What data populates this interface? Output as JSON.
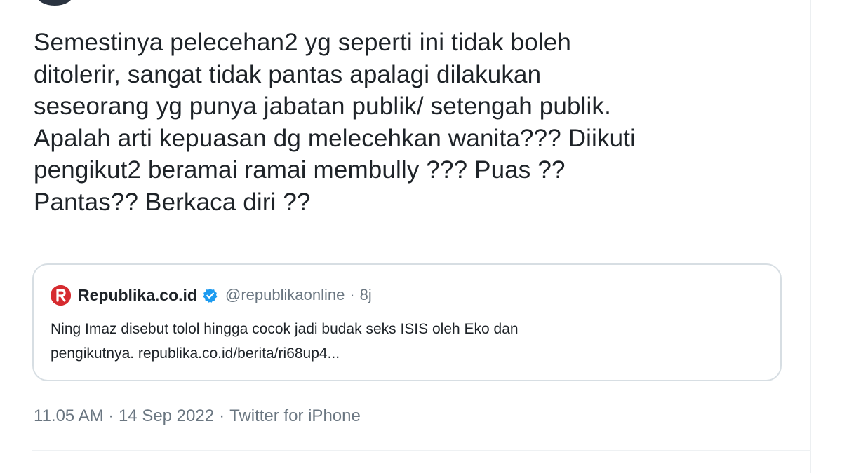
{
  "tweet": {
    "text": "Semestinya pelecehan2 yg seperti ini tidak boleh\nditolerir, sangat tidak pantas apalagi dilakukan\nseseorang yg punya jabatan publik/ setengah publik.\nApalah arti kepuasan dg melecehkan wanita??? Diikuti\npengikut2 beramai ramai membully ??? Puas ??\nPantas?? Berkaca diri ??",
    "timestamp": "11.05 AM · 14 Sep 2022",
    "separator": "·",
    "source": "Twitter for iPhone"
  },
  "quoted_tweet": {
    "avatar_icon": "republika-logo-icon",
    "name": "Republika.co.id",
    "verified_icon": "verified-badge-icon",
    "handle": "@republikaonline",
    "dot": "·",
    "time": "8j",
    "text": "Ning Imaz disebut tolol hingga cocok jadi budak seks ISIS oleh Eko dan\npengikutnya. republika.co.id/berita/ri68up4..."
  },
  "colors": {
    "text": "#1e2328",
    "secondary": "#6a7681",
    "verified": "#1d9bf0",
    "republika_red": "#d62b30",
    "border": "#d7dee3"
  }
}
